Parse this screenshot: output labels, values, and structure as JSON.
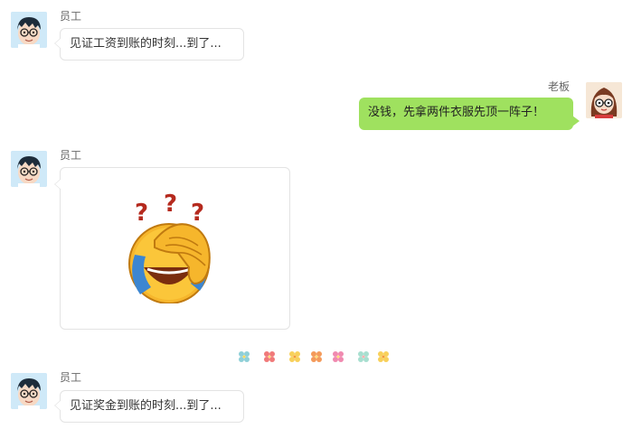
{
  "messages": [
    {
      "sender": "员工",
      "text": "见证工资到账的时刻...到了..."
    },
    {
      "sender": "老板",
      "text": "没钱，先拿两件衣服先顶一阵子！"
    },
    {
      "sender": "员工",
      "image": "facepalm-laughing-emoji-with-question-marks"
    },
    {
      "sender": "员工",
      "text": "见证奖金到账的时刻...到了..."
    }
  ],
  "divider": {
    "icon": "flower-icons"
  },
  "colors": {
    "self_bubble": "#9fe15f",
    "other_bubble": "#ffffff",
    "bubble_border": "#e3e3e3",
    "sender_text": "#666666"
  }
}
